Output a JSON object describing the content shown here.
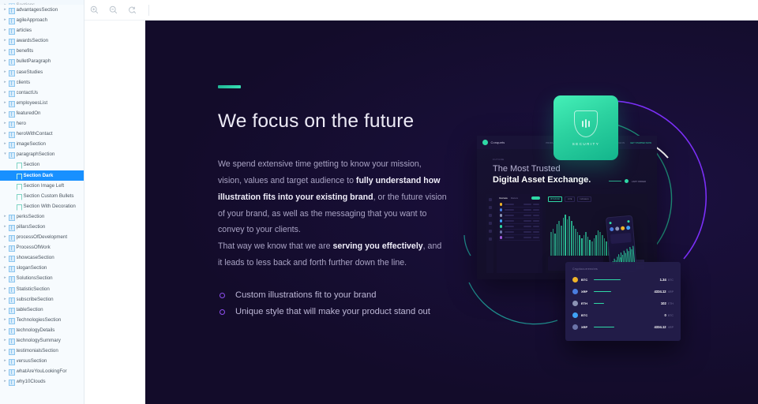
{
  "sidebar": {
    "top_cut_label": "Sections",
    "items": [
      {
        "label": "advantagesSection",
        "type": "grid",
        "level": 0,
        "expandable": true
      },
      {
        "label": "agileApproach",
        "type": "grid",
        "level": 0,
        "expandable": true
      },
      {
        "label": "articles",
        "type": "grid",
        "level": 0,
        "expandable": true
      },
      {
        "label": "awardsSection",
        "type": "grid",
        "level": 0,
        "expandable": true
      },
      {
        "label": "benefits",
        "type": "grid",
        "level": 0,
        "expandable": true
      },
      {
        "label": "bulletParagraph",
        "type": "grid",
        "level": 0,
        "expandable": true
      },
      {
        "label": "caseStudies",
        "type": "grid",
        "level": 0,
        "expandable": true
      },
      {
        "label": "clients",
        "type": "grid",
        "level": 0,
        "expandable": true
      },
      {
        "label": "contactUs",
        "type": "grid",
        "level": 0,
        "expandable": true
      },
      {
        "label": "employeesList",
        "type": "grid",
        "level": 0,
        "expandable": true
      },
      {
        "label": "featuredOn",
        "type": "grid",
        "level": 0,
        "expandable": true
      },
      {
        "label": "hero",
        "type": "grid",
        "level": 0,
        "expandable": true
      },
      {
        "label": "heroWithContact",
        "type": "grid",
        "level": 0,
        "expandable": true
      },
      {
        "label": "imageSection",
        "type": "grid",
        "level": 0,
        "expandable": true
      },
      {
        "label": "paragraphSection",
        "type": "grid",
        "level": 0,
        "expandable": true,
        "expanded": true
      },
      {
        "label": "Section",
        "type": "leaf",
        "level": 1,
        "expandable": false
      },
      {
        "label": "Section Dark",
        "type": "leaf",
        "level": 1,
        "expandable": false,
        "selected": true
      },
      {
        "label": "Section Image Left",
        "type": "leaf",
        "level": 1,
        "expandable": false
      },
      {
        "label": "Section Custom Bullets",
        "type": "leaf",
        "level": 1,
        "expandable": false,
        "wrap": true
      },
      {
        "label": "Section With Decoration",
        "type": "leaf",
        "level": 1,
        "expandable": false,
        "wrap": true
      },
      {
        "label": "perksSection",
        "type": "grid",
        "level": 0,
        "expandable": true
      },
      {
        "label": "pillarsSection",
        "type": "grid",
        "level": 0,
        "expandable": true
      },
      {
        "label": "processOfDevelopment",
        "type": "grid",
        "level": 0,
        "expandable": true
      },
      {
        "label": "ProcessOfWork",
        "type": "grid",
        "level": 0,
        "expandable": true
      },
      {
        "label": "showcaseSection",
        "type": "grid",
        "level": 0,
        "expandable": true
      },
      {
        "label": "sloganSection",
        "type": "grid",
        "level": 0,
        "expandable": true
      },
      {
        "label": "SolutionsSection",
        "type": "grid",
        "level": 0,
        "expandable": true
      },
      {
        "label": "StatisticSection",
        "type": "grid",
        "level": 0,
        "expandable": true
      },
      {
        "label": "subscribeSection",
        "type": "grid",
        "level": 0,
        "expandable": true
      },
      {
        "label": "tableSection",
        "type": "grid",
        "level": 0,
        "expandable": true
      },
      {
        "label": "TechnologiesSection",
        "type": "grid",
        "level": 0,
        "expandable": true
      },
      {
        "label": "technologyDetails",
        "type": "grid",
        "level": 0,
        "expandable": true
      },
      {
        "label": "technologySummary",
        "type": "grid",
        "level": 0,
        "expandable": true
      },
      {
        "label": "testimonialsSection",
        "type": "grid",
        "level": 0,
        "expandable": true
      },
      {
        "label": "versusSection",
        "type": "grid",
        "level": 0,
        "expandable": true
      },
      {
        "label": "whatAreYouLookingFor",
        "type": "grid",
        "level": 0,
        "expandable": true
      },
      {
        "label": "why10Clouds",
        "type": "grid",
        "level": 0,
        "expandable": true
      }
    ]
  },
  "toolbar": {
    "zoom_in": "zoom-in-icon",
    "zoom_out": "zoom-out-icon",
    "zoom_reset": "zoom-reset-icon"
  },
  "preview": {
    "headline": "We focus on the future",
    "paragraph": {
      "line1_a": "We spend extensive time getting to know your mission, vision, values and target audience to ",
      "line1_b": "fully understand how illustration fits into your existing brand",
      "line1_c": ", or the future vision of your brand, as well as the messaging that you want to convey to your clients.",
      "line2_a": "That way we know that we are ",
      "line2_b": "serving you effectively",
      "line2_c": ", and it leads to less back and forth further down the line."
    },
    "bullets": [
      "Custom illustrations fit to your brand",
      "Unique style that will make your product stand out"
    ],
    "colors": {
      "background": "#130c2a",
      "accent_teal": "#2fd8a6",
      "accent_purple": "#8e4ff0",
      "heading": "#eceaf5",
      "body_text": "#a9a3c4"
    }
  },
  "illustration": {
    "browser": {
      "brand": "Conquets",
      "eyebrow": "FUTURE",
      "heading_top": "The Most Trusted",
      "heading_bottom": "Digital Asset Exchange.",
      "nav": [
        "PRODUCT",
        "MARKET",
        "RESOURCES",
        "CONTACT US"
      ],
      "nav_right": [
        "SIGN IN"
      ],
      "cta": "GET STARTED NOW",
      "toggle_label": "LIMIT ORDER",
      "list_tabs": [
        "Overview",
        "Markets"
      ],
      "chart_tabs": [
        "BTC/USD",
        "LIVE",
        "Indicators"
      ]
    },
    "badge": {
      "label": "SECURITY",
      "icon": "shield-icon"
    },
    "crypto_card": {
      "title": "Cryptocurrencies",
      "rows": [
        {
          "symbol": "BTC",
          "value": "1.34",
          "unit": "BTC",
          "bar": 34,
          "color": "#f0b429"
        },
        {
          "symbol": "XRP",
          "value": "4334.12",
          "unit": "XRP",
          "bar": 22,
          "color": "#4a7de0"
        },
        {
          "symbol": "ETH",
          "value": "102",
          "unit": "ETH",
          "bar": 13,
          "color": "#8c93b5"
        },
        {
          "symbol": "BTC",
          "value": "0",
          "unit": "BTC",
          "bar": 0,
          "color": "#3fa2f7"
        },
        {
          "symbol": "XRP",
          "value": "4334.12",
          "unit": "XRP",
          "bar": 26,
          "color": "#6b74a8"
        }
      ]
    },
    "arcs": [
      {
        "name": "outer-purple-arc",
        "color": "#7b2ff7"
      },
      {
        "name": "inner-teal-arc",
        "color": "#1f8f7a"
      },
      {
        "name": "white-arc",
        "color": "#ffffff"
      },
      {
        "name": "bottom-left-teal-arc",
        "color": "#1f8f8f"
      },
      {
        "name": "left-small-teal-arc",
        "color": "#1f8f8f"
      }
    ]
  }
}
